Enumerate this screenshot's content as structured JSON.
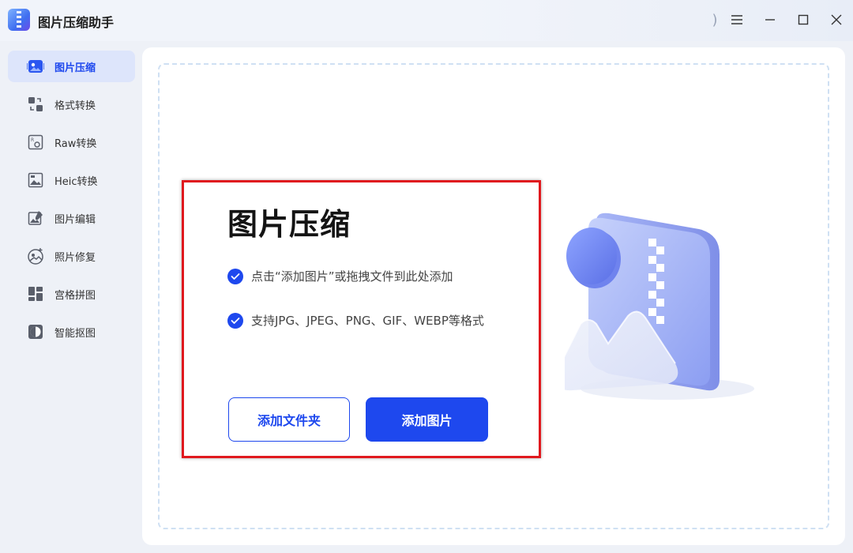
{
  "window": {
    "title": "图片压缩助手",
    "controls": {
      "extra_icon": "partial-icon",
      "menu_icon": "menu-icon",
      "minimize_icon": "minimize-icon",
      "maximize_icon": "maximize-icon",
      "close_icon": "close-icon"
    }
  },
  "sidebar": {
    "active_index": 0,
    "items": [
      {
        "label": "图片压缩",
        "icon": "image-compress-icon"
      },
      {
        "label": "格式转换",
        "icon": "format-convert-icon"
      },
      {
        "label": "Raw转换",
        "icon": "raw-convert-icon"
      },
      {
        "label": "Heic转换",
        "icon": "heic-convert-icon"
      },
      {
        "label": "图片编辑",
        "icon": "image-edit-icon"
      },
      {
        "label": "照片修复",
        "icon": "photo-repair-icon"
      },
      {
        "label": "宫格拼图",
        "icon": "grid-collage-icon"
      },
      {
        "label": "智能抠图",
        "icon": "smart-cutout-icon"
      }
    ]
  },
  "main": {
    "heading": "图片压缩",
    "features": [
      "点击“添加图片”或拖拽文件到此处添加",
      "支持JPG、JPEG、PNG、GIF、WEBP等格式"
    ],
    "buttons": {
      "add_folder": "添加文件夹",
      "add_image": "添加图片"
    }
  },
  "colors": {
    "accent": "#1e48ee",
    "active_bg": "#dde5fb",
    "highlight_border": "#e0191e",
    "dropzone_border": "#cfe0f3"
  }
}
